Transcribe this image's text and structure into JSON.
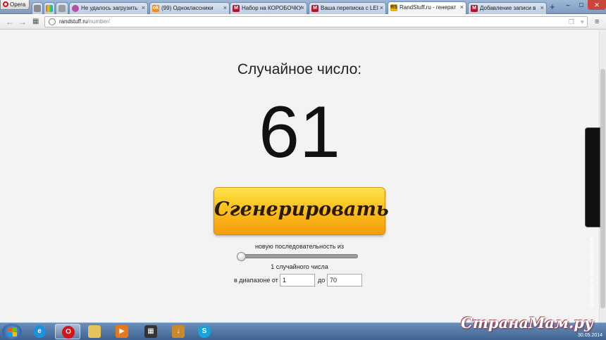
{
  "browser": {
    "menu_label": "Opera",
    "tabs": [
      {
        "title": "",
        "fav": "doc-icon"
      },
      {
        "title": "",
        "fav": "colorful-icon"
      },
      {
        "title": "",
        "fav": "flag-icon"
      },
      {
        "title": "Не удалось загрузить",
        "fav": "power-icon"
      },
      {
        "title": "(99) Одноклассники",
        "fav": "ok-icon"
      },
      {
        "title": "Набор на КОРОБОЧКУ",
        "fav": "m-icon"
      },
      {
        "title": "Ваша переписка с LEI",
        "fav": "m-icon"
      },
      {
        "title": "RandStuff.ru - генерат",
        "fav": "rs-icon"
      },
      {
        "title": "Добавление записи в",
        "fav": "m-icon"
      }
    ],
    "url_host": "randstuff.ru",
    "url_path": "/number/"
  },
  "page": {
    "heading": "Случайное число:",
    "result": "61",
    "generate_label": "Сгенерировать",
    "sequence_label": "новую последовательность из",
    "sequence_value": 1,
    "count_label": "1 случайного числа",
    "range_from_label": "в диапазоне от",
    "range_to_label": "до",
    "min_value": "1",
    "max_value": "70",
    "feedback_label": "Отзывы и предложения"
  },
  "taskbar": {
    "apps": [
      "ie-icon",
      "opera-icon",
      "folder-icon",
      "media-icon",
      "clapper-icon",
      "download-icon",
      "skype-icon"
    ],
    "watermark": "СтранаМам.ру",
    "clock_date": "30.05.2014"
  },
  "colors": {
    "button_top": "#fde24b",
    "button_bottom": "#f59b0f",
    "accent": "#cc0f16"
  }
}
